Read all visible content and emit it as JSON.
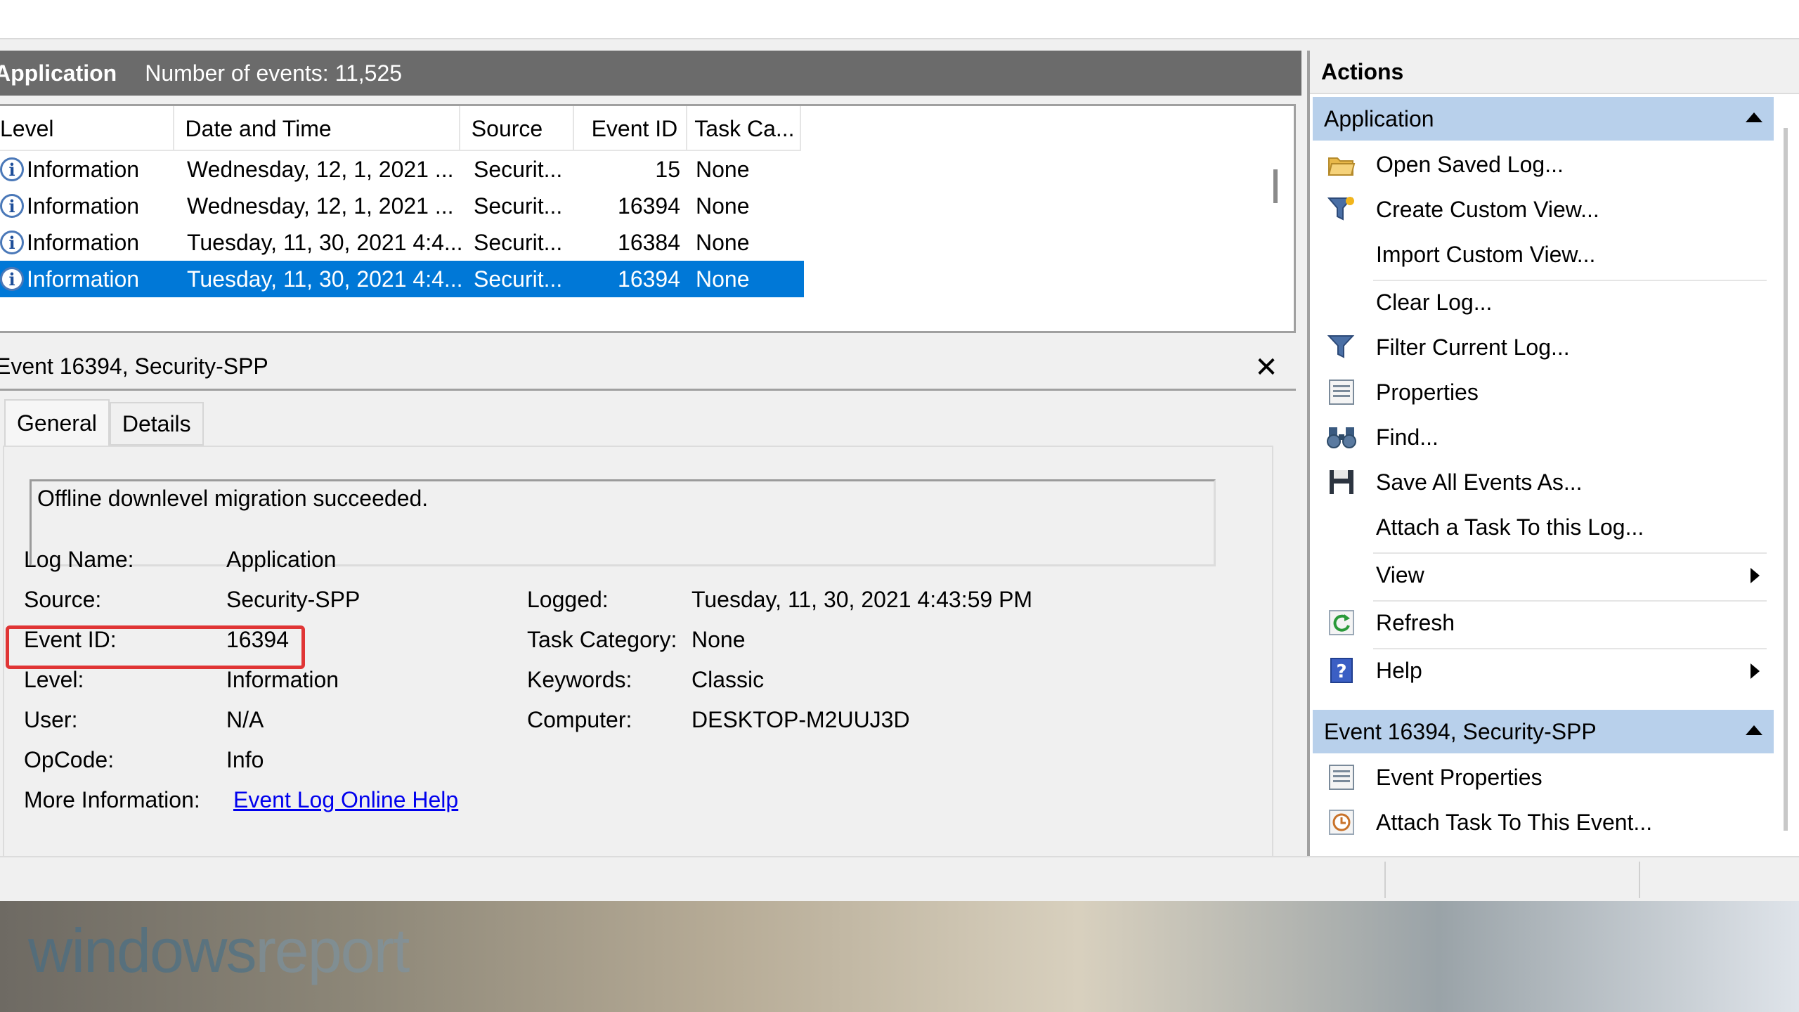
{
  "log": {
    "name": "Application",
    "count_label": "Number of events: 11,525"
  },
  "columns": [
    "Level",
    "Date and Time",
    "Source",
    "Event ID",
    "Task Ca..."
  ],
  "events": [
    {
      "level": "Information",
      "date": "Wednesday, 12, 1, 2021 ...",
      "source": "Securit...",
      "id": "15",
      "task": "None"
    },
    {
      "level": "Information",
      "date": "Wednesday, 12, 1, 2021 ...",
      "source": "Securit...",
      "id": "16394",
      "task": "None"
    },
    {
      "level": "Information",
      "date": "Tuesday, 11, 30, 2021 4:4...",
      "source": "Securit...",
      "id": "16384",
      "task": "None"
    },
    {
      "level": "Information",
      "date": "Tuesday, 11, 30, 2021 4:4...",
      "source": "Securit...",
      "id": "16394",
      "task": "None"
    }
  ],
  "detail": {
    "title": "Event 16394, Security-SPP",
    "close": "✕",
    "tabs": [
      "General",
      "Details"
    ],
    "description": "Offline downlevel migration succeeded.",
    "log_name_label": "Log Name:",
    "log_name": "Application",
    "source_label": "Source:",
    "source": "Security-SPP",
    "event_id_label": "Event ID:",
    "event_id": "16394",
    "level_label": "Level:",
    "level": "Information",
    "user_label": "User:",
    "user": "N/A",
    "opcode_label": "OpCode:",
    "opcode": "Info",
    "more_info_label": "More Information:",
    "more_info_link": "Event Log Online Help",
    "logged_label": "Logged:",
    "logged": "Tuesday, 11, 30, 2021 4:43:59 PM",
    "task_category_label": "Task Category:",
    "task_category": "None",
    "keywords_label": "Keywords:",
    "keywords": "Classic",
    "computer_label": "Computer:",
    "computer": "DESKTOP-M2UUJ3D"
  },
  "actions": {
    "title": "Actions",
    "section1": "Application",
    "items1": [
      {
        "label": "Open Saved Log...",
        "icon": "folder-open-icon"
      },
      {
        "label": "Create Custom View...",
        "icon": "filter-star-icon"
      },
      {
        "label": "Import Custom View...",
        "icon": ""
      },
      {
        "label": "Clear Log...",
        "icon": ""
      },
      {
        "label": "Filter Current Log...",
        "icon": "filter-icon"
      },
      {
        "label": "Properties",
        "icon": "properties-icon"
      },
      {
        "label": "Find...",
        "icon": "binoculars-icon"
      },
      {
        "label": "Save All Events As...",
        "icon": "save-icon"
      },
      {
        "label": "Attach a Task To this Log...",
        "icon": ""
      },
      {
        "label": "View",
        "icon": ""
      },
      {
        "label": "Refresh",
        "icon": "refresh-icon"
      },
      {
        "label": "Help",
        "icon": "help-icon"
      }
    ],
    "section2": "Event 16394, Security-SPP",
    "items2": [
      {
        "label": "Event Properties",
        "icon": "properties-icon"
      },
      {
        "label": "Attach Task To This Event...",
        "icon": "task-clock-icon"
      }
    ]
  },
  "wallpaper": {
    "watermark_a": "windows",
    "watermark_b": "report"
  },
  "colors": {
    "selection": "#0078d7",
    "section_header": "#b8d0eb",
    "highlight_box": "#e03535",
    "link": "#0000ee"
  }
}
